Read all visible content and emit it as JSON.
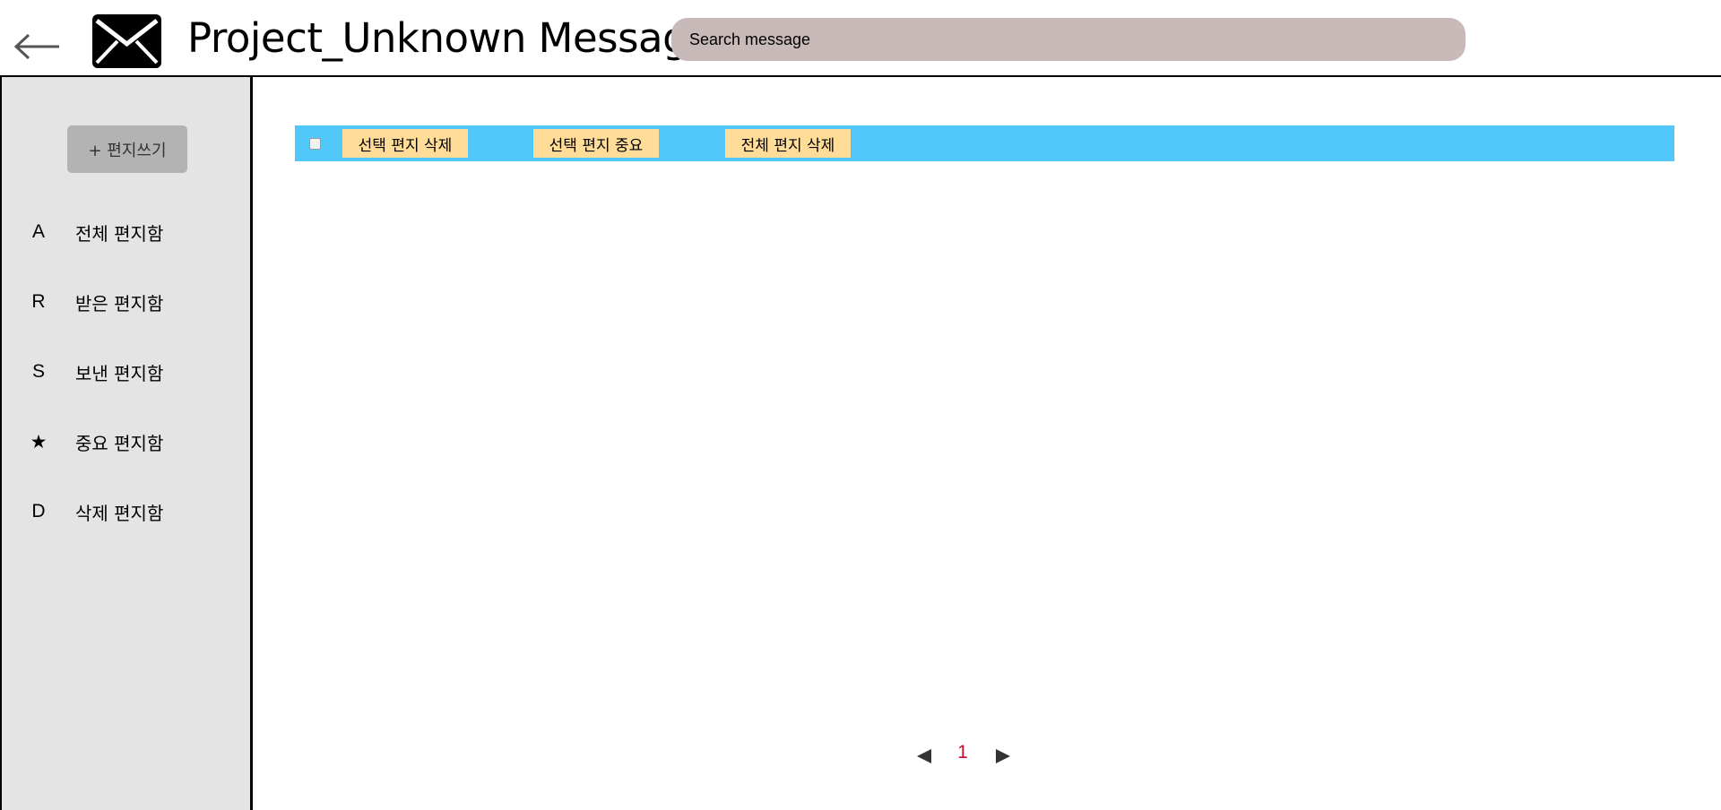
{
  "header": {
    "back_icon": "left-arrow-icon",
    "logo_icon": "envelope-icon",
    "title": "Project_Unknown Message",
    "search_placeholder": "Search message"
  },
  "sidebar": {
    "compose_label": "+ 편지쓰기",
    "items": [
      {
        "icon": "A",
        "label": "전체 편지함"
      },
      {
        "icon": "R",
        "label": "받은 편지함"
      },
      {
        "icon": "S",
        "label": "보낸 편지함"
      },
      {
        "icon": "★",
        "label": "중요 편지함"
      },
      {
        "icon": "D",
        "label": "삭제 편지함"
      }
    ]
  },
  "toolbar": {
    "delete_selected": "선택 편지 삭제",
    "mark_important": "선택 편지 중요",
    "delete_all": "전체 편지 삭제"
  },
  "pagination": {
    "current_page": "1"
  },
  "colors": {
    "toolbar_bg": "#52c8fa",
    "button_bg": "#ffdd98",
    "sidebar_bg": "#e4e4e4",
    "search_bg": "#c8bab8",
    "compose_bg": "#b3b3b3",
    "page_number": "#c8102e"
  }
}
